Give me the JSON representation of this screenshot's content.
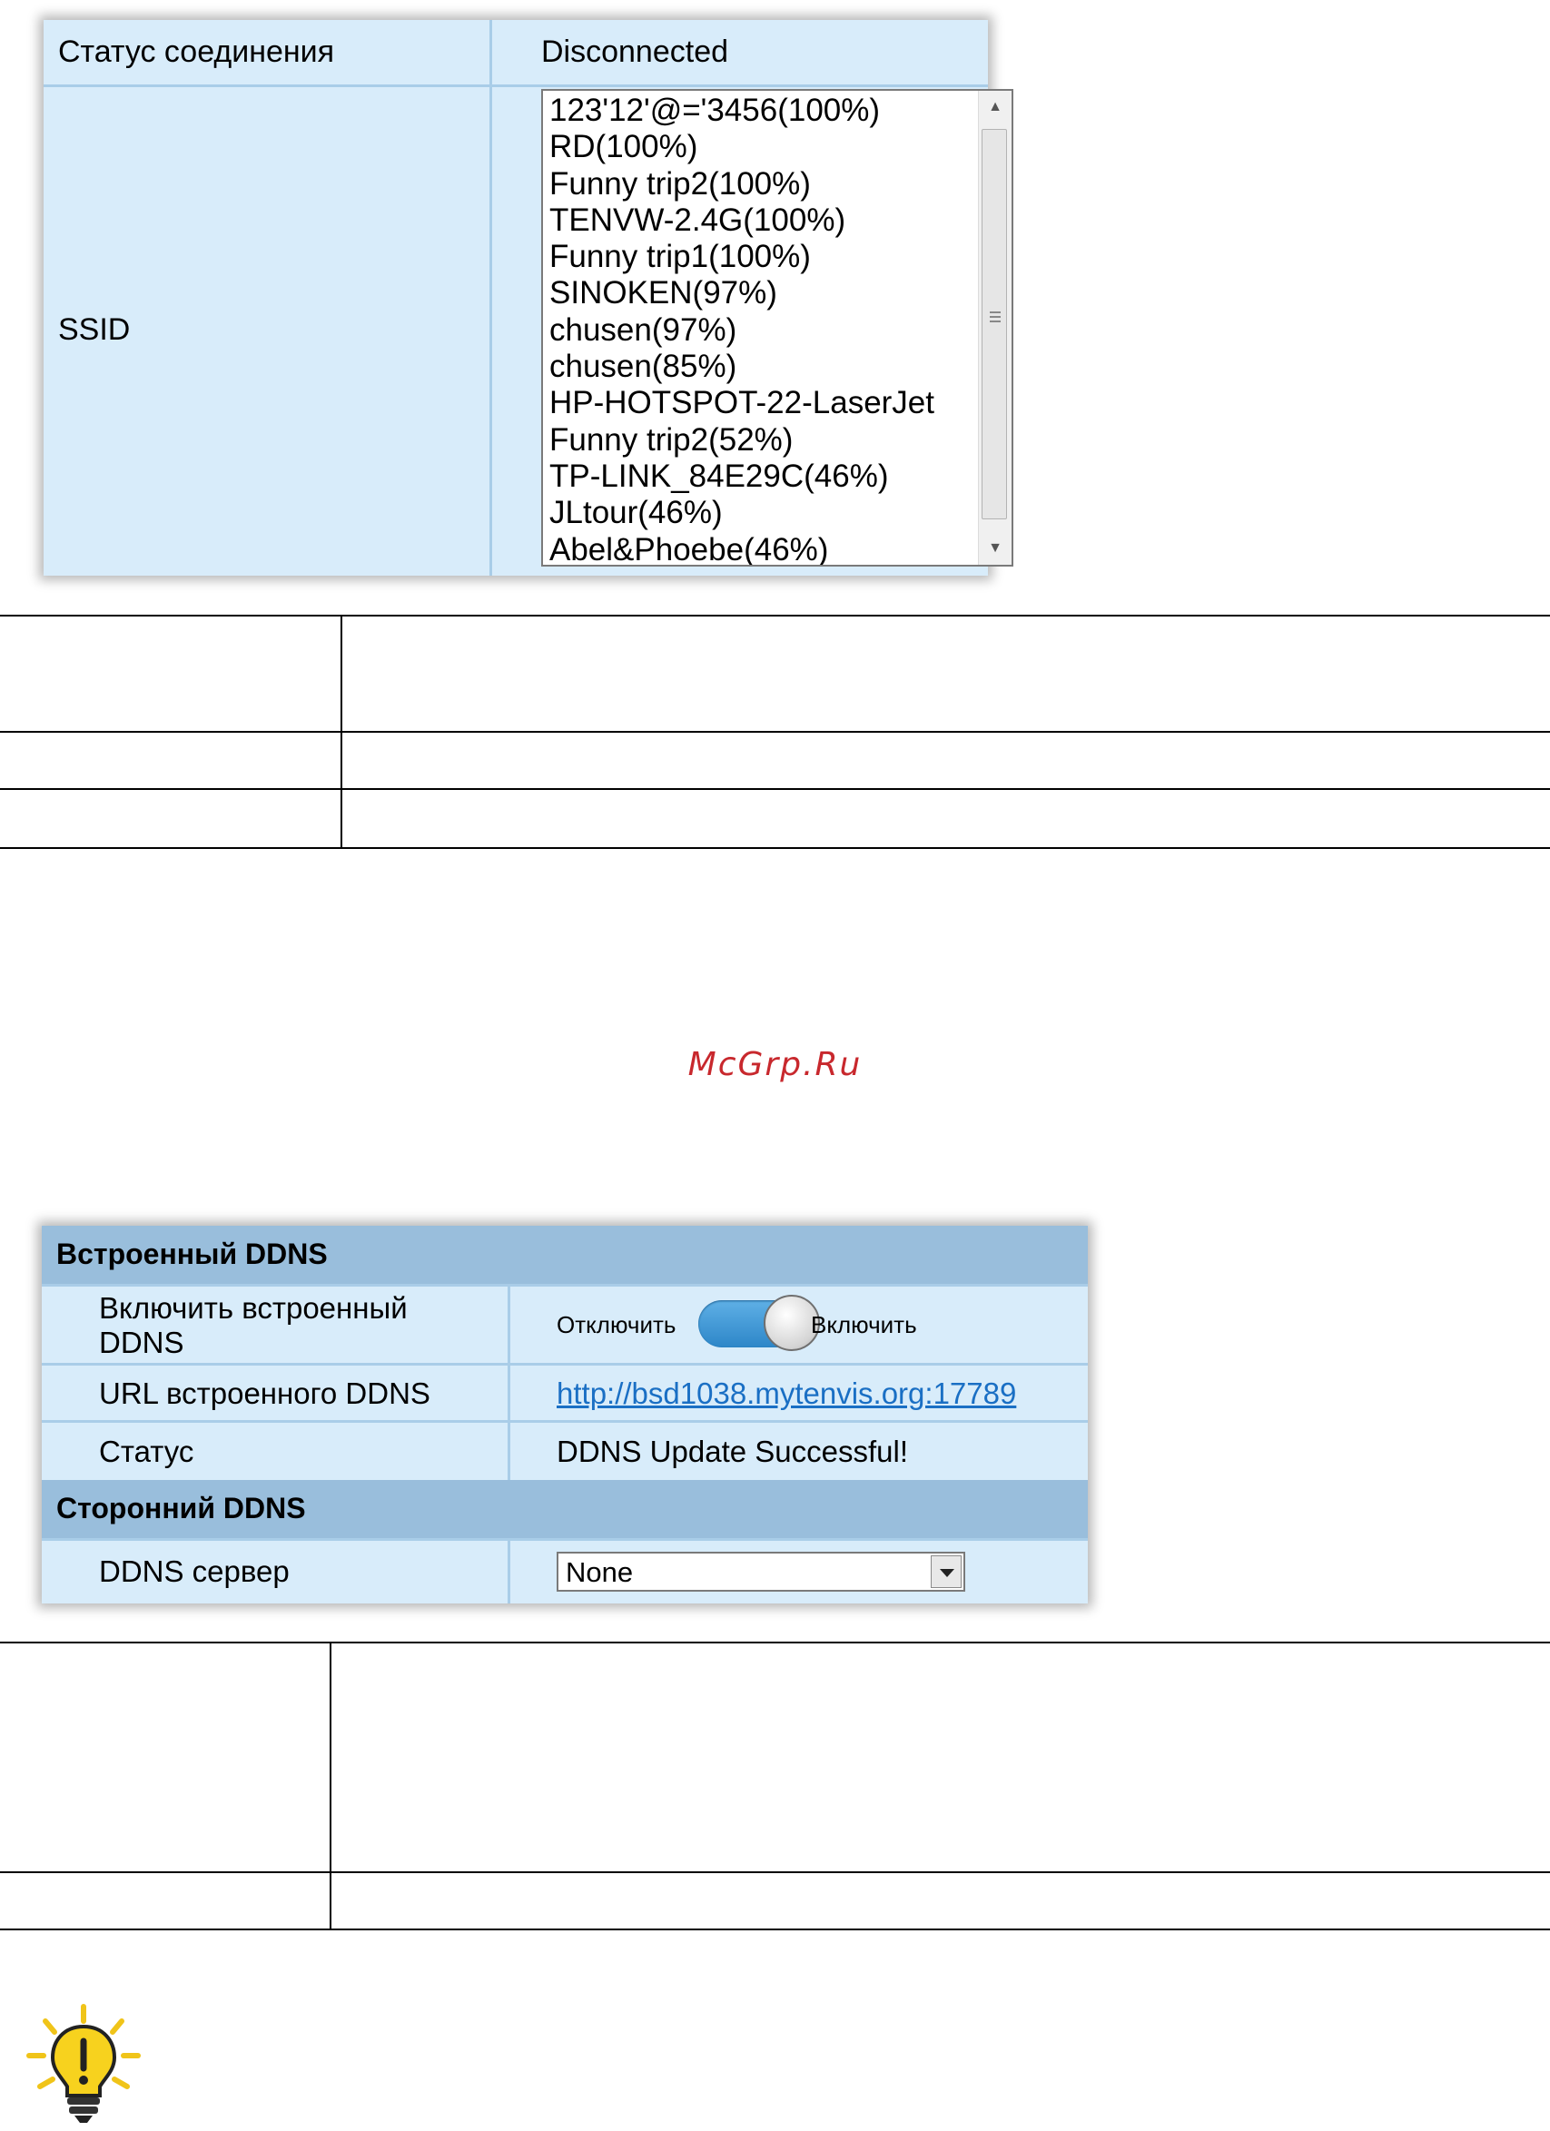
{
  "status_panel": {
    "connection_label": "Статус соединения",
    "connection_value": "Disconnected",
    "ssid_label": "SSID",
    "ssid_list": [
      "123'12'@='3456(100%)",
      "RD(100%)",
      "Funny trip2(100%)",
      "TENVW-2.4G(100%)",
      "Funny trip1(100%)",
      "SINOKEN(97%)",
      "chusen(97%)",
      "chusen(85%)",
      "HP-HOTSPOT-22-LaserJet",
      "Funny trip2(52%)",
      "TP-LINK_84E29C(46%)",
      "JLtour(46%)",
      "Abel&Phoebe(46%)"
    ]
  },
  "watermark": "McGrp.Ru",
  "ddns_panel": {
    "builtin_header": "Встроенный DDNS",
    "enable_label": "Включить встроенный DDNS",
    "toggle_off": "Отключить",
    "toggle_on": "Включить",
    "url_label": "URL встроенного DDNS",
    "url_value": "http://bsd1038.mytenvis.org:17789",
    "status_label": "Статус",
    "status_value": "DDNS Update Successful!",
    "third_party_header": "Сторонний DDNS",
    "server_label": "DDNS сервер",
    "server_value": "None"
  },
  "icons": {
    "tip": "lightbulb-exclamation-icon",
    "tip_color": "#f7d21e"
  }
}
